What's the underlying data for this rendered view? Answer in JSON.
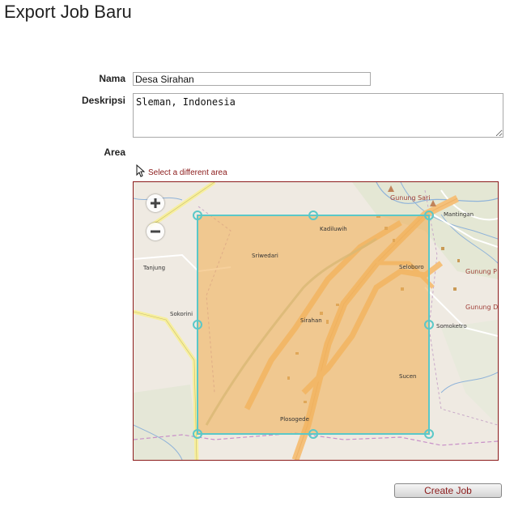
{
  "page": {
    "title": "Export Job Baru"
  },
  "form": {
    "name_label": "Nama",
    "name_value": "Desa Sirahan",
    "description_label": "Deskripsi",
    "description_value": "Sleman, Indonesia",
    "area_label": "Area",
    "select_area_link": "Select a different area",
    "submit_label": "Create Job"
  },
  "map": {
    "zoom_in_symbol": "+",
    "zoom_out_symbol": "−",
    "selection_color": "#5bc8c8",
    "selection_fill": "#f0b05a",
    "place_labels": {
      "gunung_sari": "Gunung Sari",
      "mantingan": "Mantingan",
      "tanjung": "Tanjung",
      "kadiluwih": "Kadiluwih",
      "sriwedari": "Sriwedari",
      "seloboro": "Seloboro",
      "gunung_p": "Gunung P",
      "gunung_d": "Gunung D",
      "sokorini": "Sokorini",
      "sirahan": "Sirahan",
      "somoketro": "Somoketro",
      "sucen": "Sucen",
      "plosogede": "Plosogede"
    }
  },
  "icons": {
    "cursor": "cursor-icon",
    "zoom_in": "zoom-in-icon",
    "zoom_out": "zoom-out-icon"
  }
}
